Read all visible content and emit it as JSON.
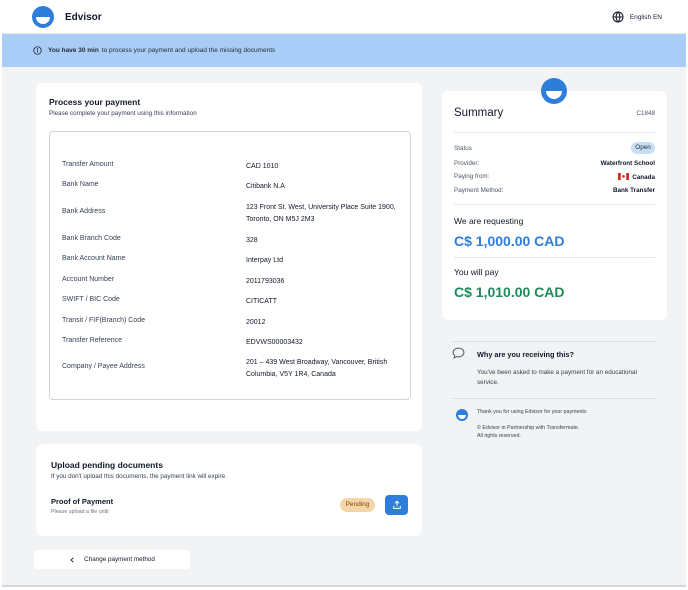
{
  "header": {
    "brand": "Edvisor",
    "language": "English EN"
  },
  "alert": {
    "bold": "You have 30 min",
    "text": "to process your payment and upload the missing documents"
  },
  "payment": {
    "title": "Process your payment",
    "subtitle": "Please complete your payment using this information",
    "rows": [
      {
        "label": "Transfer Amount",
        "value": "CAD 1010"
      },
      {
        "label": "Bank Name",
        "value": "Citibank N.A"
      },
      {
        "label": "Bank Address",
        "value": "123 Front St. West, University Place Suite 1900, Toronto, ON M5J 2M3"
      },
      {
        "label": "Bank Branch Code",
        "value": "328"
      },
      {
        "label": "Bank Account Name",
        "value": "Interpay Ltd"
      },
      {
        "label": "Account Number",
        "value": "2011793036"
      },
      {
        "label": "SWIFT / BIC Code",
        "value": "CITICATT"
      },
      {
        "label": "Transit / FIF(Branch) Code",
        "value": "20012"
      },
      {
        "label": "Transfer Reference",
        "value": "EDVWS00003432"
      },
      {
        "label": "Company / Payee Address",
        "value": "201 – 439 West Broadway, Vancouver, British Columbia, V5Y 1R4, Canada"
      }
    ]
  },
  "upload": {
    "title": "Upload pending documents",
    "subtitle": "If you don't upload this documents, the payment link will expire.",
    "item_title": "Proof of Payment",
    "item_sub": "Please upload a file until:",
    "status": "Pending"
  },
  "change_method": "Change payment method",
  "summary": {
    "title": "Summary",
    "code": "C1848",
    "status_label": "Status",
    "status_value": "Open",
    "provider_label": "Provider:",
    "provider_value": "Waterfront School",
    "paying_label": "Paying from:",
    "paying_value": "Canada",
    "method_label": "Payment Method:",
    "method_value": "Bank Transfer",
    "requesting_label": "We are requesting",
    "requesting_amount": "C$ 1,000.00 CAD",
    "pay_label": "You will pay",
    "pay_amount": "C$ 1,010.00 CAD"
  },
  "why": {
    "title": "Why are you receiving this?",
    "text": "You've been asked to make a payment for an educational service."
  },
  "footer": {
    "thanks": "Thank you for using Edvisor for your payments",
    "partner": "© Edvisor in Partnership with Transfermate.",
    "rights": "All rights reserved."
  },
  "colors": {
    "accent": "#2f7ddb",
    "alert_bg": "#a9cdf7",
    "success": "#1e8a5a",
    "pending_bg": "#f6d6a8",
    "page_bg": "#f1f3f5"
  }
}
